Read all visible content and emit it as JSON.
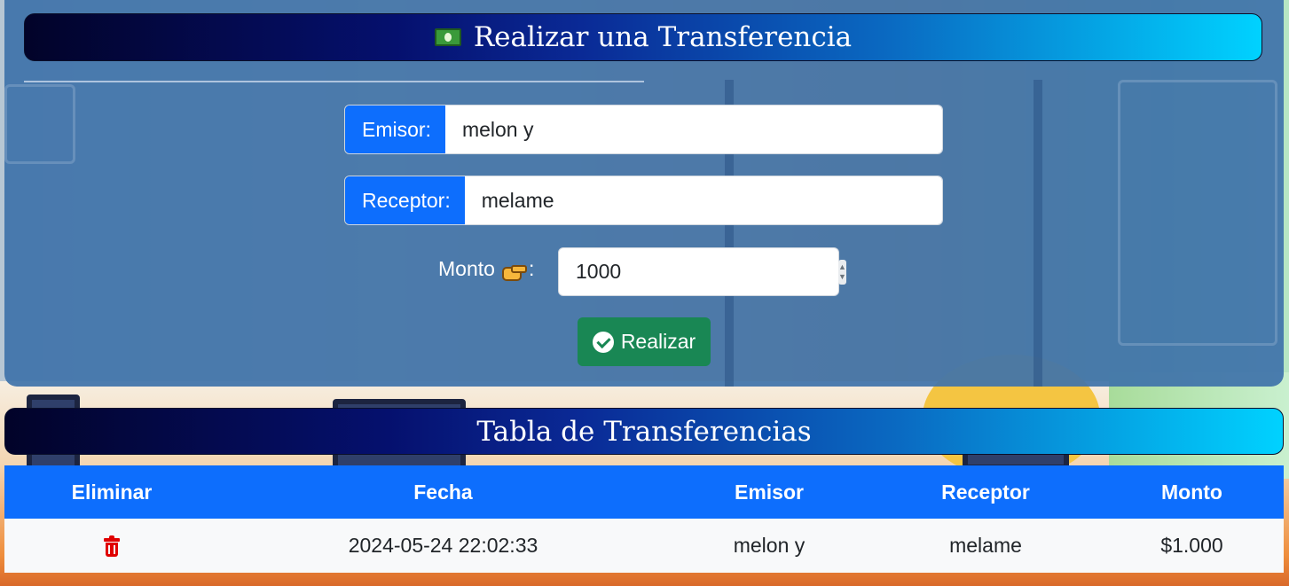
{
  "transfer_form": {
    "title": "Realizar una Transferencia",
    "emisor_label": "Emisor:",
    "emisor_value": "melon y",
    "receptor_label": "Receptor:",
    "receptor_value": "melame",
    "monto_label": "Monto",
    "monto_suffix": ":",
    "monto_value": "1000",
    "submit_label": "Realizar"
  },
  "transfers_table": {
    "title": "Tabla de Transferencias",
    "columns": [
      "Eliminar",
      "Fecha",
      "Emisor",
      "Receptor",
      "Monto"
    ],
    "rows": [
      {
        "fecha": "2024-05-24 22:02:33",
        "emisor": "melon y",
        "receptor": "melame",
        "monto": "$1.000"
      }
    ]
  },
  "colors": {
    "primary": "#0d6efd",
    "success": "#198754",
    "danger": "#e00000",
    "title_gradient_start": "#020329",
    "title_gradient_end": "#00d2ff"
  },
  "icons": {
    "title": "money-bill-icon",
    "monto": "pointing-hand-icon",
    "submit": "check-circle-icon",
    "delete": "trash-icon"
  }
}
